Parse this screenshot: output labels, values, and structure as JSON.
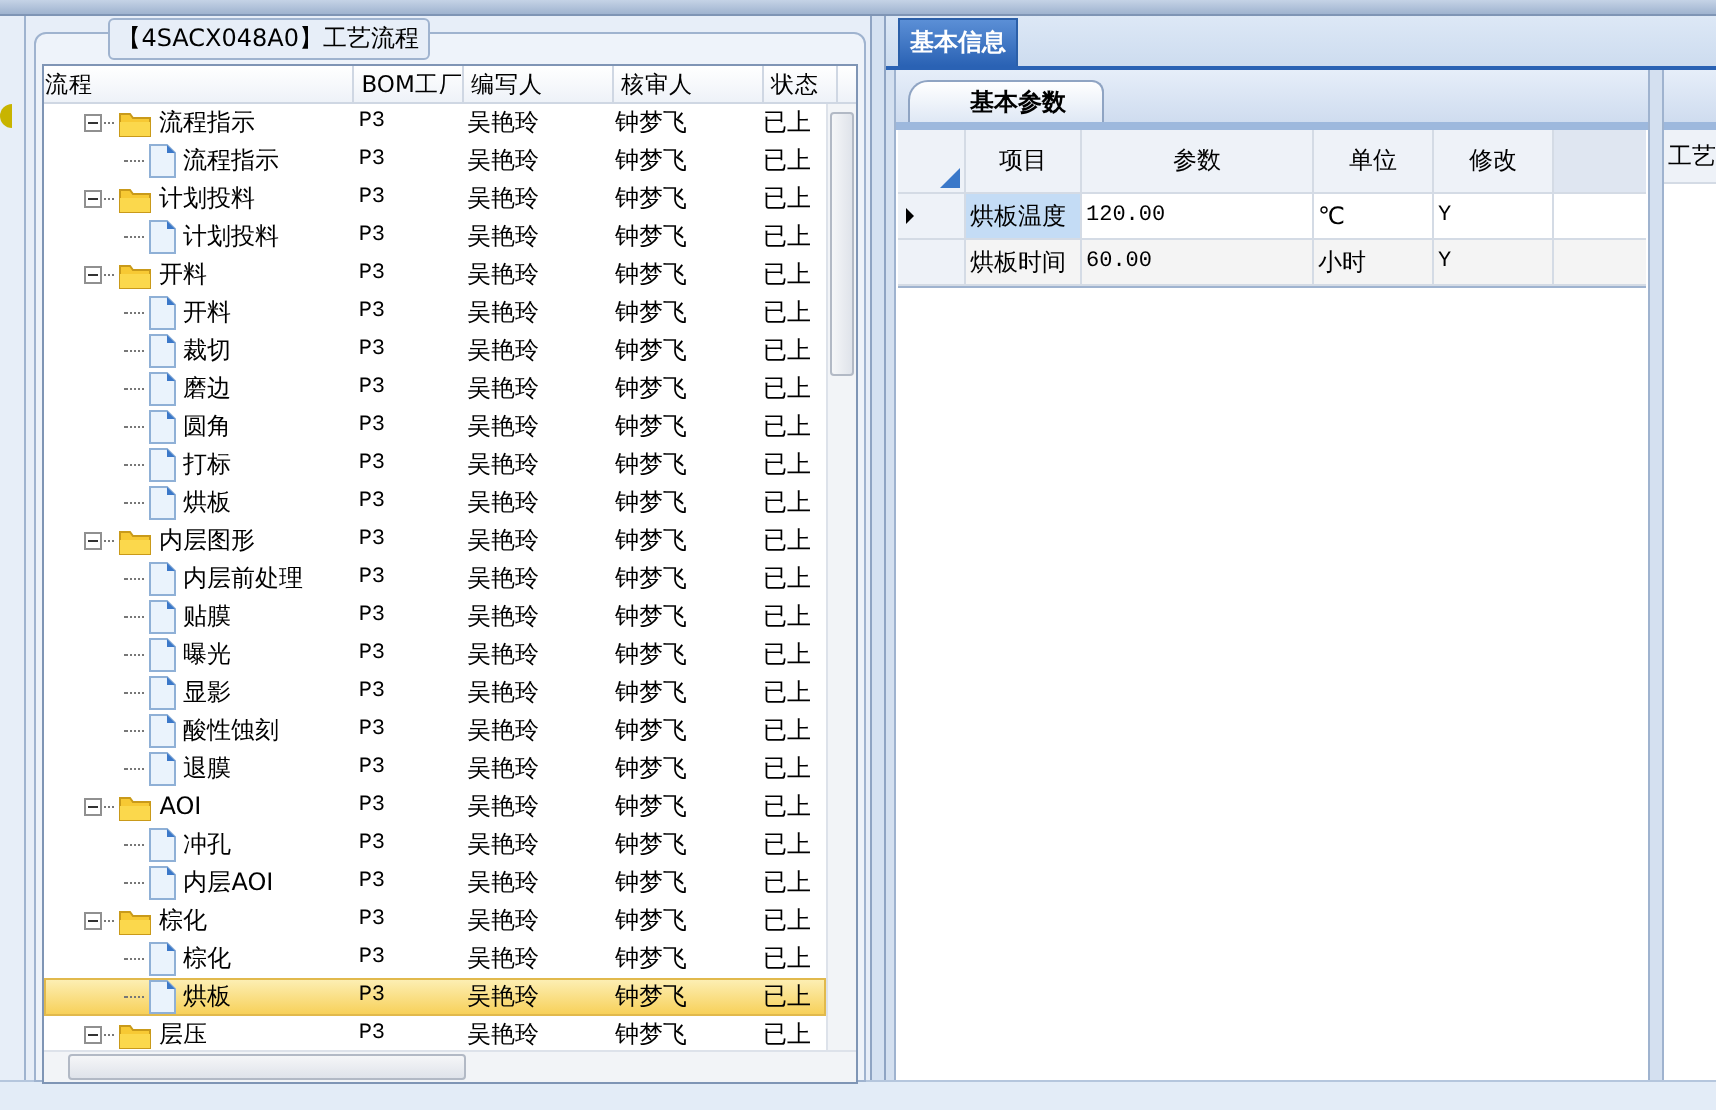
{
  "left_panel": {
    "title": "【4SACX048A0】工艺流程"
  },
  "tree_grid": {
    "columns": [
      "流程",
      "BOM工厂",
      "编写人",
      "核审人",
      "状态"
    ],
    "rows": [
      {
        "kind": "folder",
        "label": "流程指示",
        "bom": "P3",
        "writer": "吴艳玲",
        "reviewer": "钟梦飞",
        "status": "已上",
        "expanded": true,
        "selected": false,
        "children": [
          {
            "kind": "file",
            "label": "流程指示",
            "bom": "P3",
            "writer": "吴艳玲",
            "reviewer": "钟梦飞",
            "status": "已上",
            "selected": false
          }
        ]
      },
      {
        "kind": "folder",
        "label": "计划投料",
        "bom": "P3",
        "writer": "吴艳玲",
        "reviewer": "钟梦飞",
        "status": "已上",
        "expanded": true,
        "selected": false,
        "children": [
          {
            "kind": "file",
            "label": "计划投料",
            "bom": "P3",
            "writer": "吴艳玲",
            "reviewer": "钟梦飞",
            "status": "已上",
            "selected": false
          }
        ]
      },
      {
        "kind": "folder",
        "label": "开料",
        "bom": "P3",
        "writer": "吴艳玲",
        "reviewer": "钟梦飞",
        "status": "已上",
        "expanded": true,
        "selected": false,
        "children": [
          {
            "kind": "file",
            "label": "开料",
            "bom": "P3",
            "writer": "吴艳玲",
            "reviewer": "钟梦飞",
            "status": "已上",
            "selected": false
          },
          {
            "kind": "file",
            "label": "裁切",
            "bom": "P3",
            "writer": "吴艳玲",
            "reviewer": "钟梦飞",
            "status": "已上",
            "selected": false
          },
          {
            "kind": "file",
            "label": "磨边",
            "bom": "P3",
            "writer": "吴艳玲",
            "reviewer": "钟梦飞",
            "status": "已上",
            "selected": false
          },
          {
            "kind": "file",
            "label": "圆角",
            "bom": "P3",
            "writer": "吴艳玲",
            "reviewer": "钟梦飞",
            "status": "已上",
            "selected": false
          },
          {
            "kind": "file",
            "label": "打标",
            "bom": "P3",
            "writer": "吴艳玲",
            "reviewer": "钟梦飞",
            "status": "已上",
            "selected": false
          },
          {
            "kind": "file",
            "label": "烘板",
            "bom": "P3",
            "writer": "吴艳玲",
            "reviewer": "钟梦飞",
            "status": "已上",
            "selected": false
          }
        ]
      },
      {
        "kind": "folder",
        "label": "内层图形",
        "bom": "P3",
        "writer": "吴艳玲",
        "reviewer": "钟梦飞",
        "status": "已上",
        "expanded": true,
        "selected": false,
        "children": [
          {
            "kind": "file",
            "label": "内层前处理",
            "bom": "P3",
            "writer": "吴艳玲",
            "reviewer": "钟梦飞",
            "status": "已上",
            "selected": false
          },
          {
            "kind": "file",
            "label": "贴膜",
            "bom": "P3",
            "writer": "吴艳玲",
            "reviewer": "钟梦飞",
            "status": "已上",
            "selected": false
          },
          {
            "kind": "file",
            "label": "曝光",
            "bom": "P3",
            "writer": "吴艳玲",
            "reviewer": "钟梦飞",
            "status": "已上",
            "selected": false
          },
          {
            "kind": "file",
            "label": "显影",
            "bom": "P3",
            "writer": "吴艳玲",
            "reviewer": "钟梦飞",
            "status": "已上",
            "selected": false
          },
          {
            "kind": "file",
            "label": "酸性蚀刻",
            "bom": "P3",
            "writer": "吴艳玲",
            "reviewer": "钟梦飞",
            "status": "已上",
            "selected": false
          },
          {
            "kind": "file",
            "label": "退膜",
            "bom": "P3",
            "writer": "吴艳玲",
            "reviewer": "钟梦飞",
            "status": "已上",
            "selected": false
          }
        ]
      },
      {
        "kind": "folder",
        "label": "AOI",
        "bom": "P3",
        "writer": "吴艳玲",
        "reviewer": "钟梦飞",
        "status": "已上",
        "expanded": true,
        "selected": false,
        "children": [
          {
            "kind": "file",
            "label": "冲孔",
            "bom": "P3",
            "writer": "吴艳玲",
            "reviewer": "钟梦飞",
            "status": "已上",
            "selected": false
          },
          {
            "kind": "file",
            "label": "内层AOI",
            "bom": "P3",
            "writer": "吴艳玲",
            "reviewer": "钟梦飞",
            "status": "已上",
            "selected": false
          }
        ]
      },
      {
        "kind": "folder",
        "label": "棕化",
        "bom": "P3",
        "writer": "吴艳玲",
        "reviewer": "钟梦飞",
        "status": "已上",
        "expanded": true,
        "selected": false,
        "children": [
          {
            "kind": "file",
            "label": "棕化",
            "bom": "P3",
            "writer": "吴艳玲",
            "reviewer": "钟梦飞",
            "status": "已上",
            "selected": false
          },
          {
            "kind": "file",
            "label": "烘板",
            "bom": "P3",
            "writer": "吴艳玲",
            "reviewer": "钟梦飞",
            "status": "已上",
            "selected": true
          }
        ]
      },
      {
        "kind": "folder",
        "label": "层压",
        "bom": "P3",
        "writer": "吴艳玲",
        "reviewer": "钟梦飞",
        "status": "已上",
        "expanded": true,
        "selected": false
      }
    ]
  },
  "tabs": [
    {
      "label": "基本信息",
      "selected": true
    }
  ],
  "sub_tabs": [
    {
      "label": "基本参数",
      "selected": true
    }
  ],
  "param_grid": {
    "columns": [
      "项目",
      "参数",
      "单位",
      "修改"
    ],
    "rows": [
      {
        "item": "烘板温度",
        "value": "120.00",
        "unit": "℃",
        "modify": "Y",
        "selected": true
      },
      {
        "item": "烘板时间",
        "value": "60.00",
        "unit": "小时",
        "modify": "Y",
        "selected": false
      }
    ]
  },
  "right_panel": {
    "title": "工艺"
  }
}
